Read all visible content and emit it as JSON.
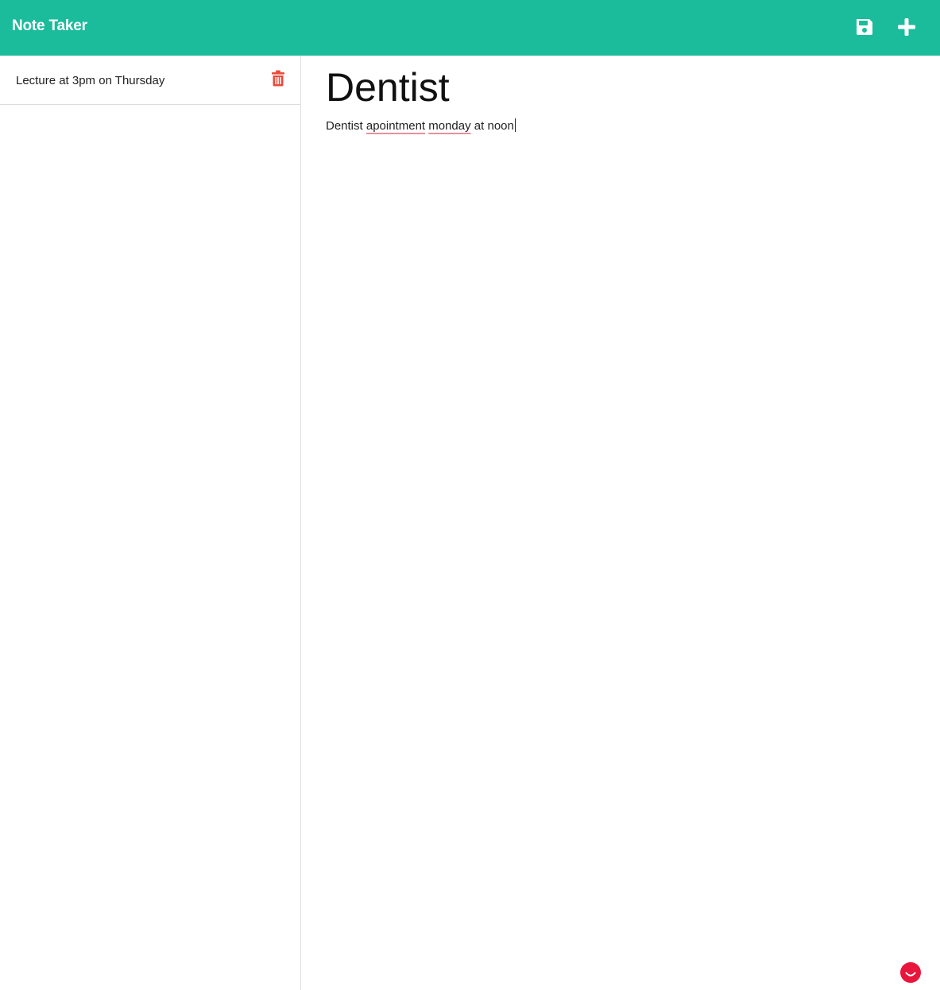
{
  "app": {
    "title": "Note Taker"
  },
  "toolbar": {
    "save_icon": "floppy-disk-icon",
    "add_icon": "plus-icon"
  },
  "sidebar": {
    "notes": [
      {
        "title": "Lecture at 3pm on Thursday",
        "delete_icon": "trash-icon"
      }
    ]
  },
  "editor": {
    "title_value": "Dentist",
    "text_words": {
      "w1": "Dentist",
      "w2": "apointment",
      "w3": "monday",
      "w4": "at noon"
    }
  },
  "colors": {
    "navbar": "#1abc9c",
    "delete_icon": "#e74c3c",
    "chat_badge": "#e8163c",
    "spellcheck_underline": "#e8909c"
  },
  "widget": {
    "chat_icon": "smile-chat-icon"
  }
}
